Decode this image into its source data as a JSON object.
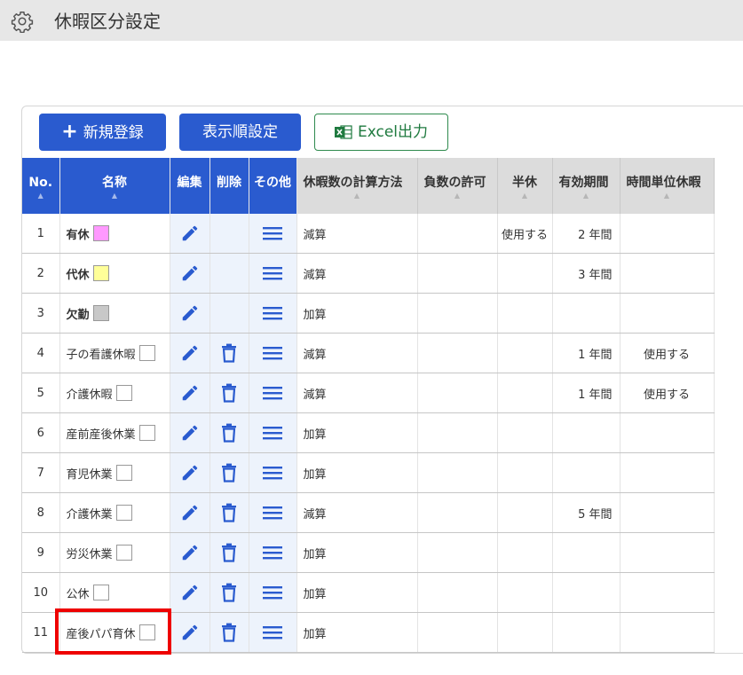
{
  "header": {
    "title": "休暇区分設定",
    "icon": "gear-icon"
  },
  "toolbar": {
    "new_label": "新規登録",
    "order_label": "表示順設定",
    "excel_label": "Excel出力"
  },
  "table": {
    "columns": {
      "no": "No.",
      "name": "名称",
      "edit": "編集",
      "delete": "削除",
      "other": "その他",
      "calc": "休暇数の計算方法",
      "negative": "負数の許可",
      "half": "半休",
      "period": "有効期間",
      "hourly": "時間単位休暇"
    },
    "rows": [
      {
        "no": "1",
        "name": "有休",
        "bold": true,
        "color": "#ff99ff",
        "deletable": false,
        "calc": "減算",
        "negative": "",
        "half": "使用する",
        "period": "2 年間",
        "hourly": ""
      },
      {
        "no": "2",
        "name": "代休",
        "bold": true,
        "color": "#ffff99",
        "deletable": false,
        "calc": "減算",
        "negative": "",
        "half": "",
        "period": "3 年間",
        "hourly": ""
      },
      {
        "no": "3",
        "name": "欠勤",
        "bold": true,
        "color": "#c8c8c8",
        "deletable": false,
        "calc": "加算",
        "negative": "",
        "half": "",
        "period": "",
        "hourly": ""
      },
      {
        "no": "4",
        "name": "子の看護休暇",
        "bold": false,
        "color": "#ffffff",
        "deletable": true,
        "calc": "減算",
        "negative": "",
        "half": "",
        "period": "1 年間",
        "hourly": "使用する"
      },
      {
        "no": "5",
        "name": "介護休暇",
        "bold": false,
        "color": "#ffffff",
        "deletable": true,
        "calc": "減算",
        "negative": "",
        "half": "",
        "period": "1 年間",
        "hourly": "使用する"
      },
      {
        "no": "6",
        "name": "産前産後休業",
        "bold": false,
        "color": "#ffffff",
        "deletable": true,
        "calc": "加算",
        "negative": "",
        "half": "",
        "period": "",
        "hourly": ""
      },
      {
        "no": "7",
        "name": "育児休業",
        "bold": false,
        "color": "#ffffff",
        "deletable": true,
        "calc": "加算",
        "negative": "",
        "half": "",
        "period": "",
        "hourly": ""
      },
      {
        "no": "8",
        "name": "介護休業",
        "bold": false,
        "color": "#ffffff",
        "deletable": true,
        "calc": "減算",
        "negative": "",
        "half": "",
        "period": "5 年間",
        "hourly": ""
      },
      {
        "no": "9",
        "name": "労災休業",
        "bold": false,
        "color": "#ffffff",
        "deletable": true,
        "calc": "加算",
        "negative": "",
        "half": "",
        "period": "",
        "hourly": ""
      },
      {
        "no": "10",
        "name": "公休",
        "bold": false,
        "color": "#ffffff",
        "deletable": true,
        "calc": "加算",
        "negative": "",
        "half": "",
        "period": "",
        "hourly": ""
      },
      {
        "no": "11",
        "name": "産後パパ育休",
        "bold": false,
        "color": "#ffffff",
        "deletable": true,
        "calc": "加算",
        "negative": "",
        "half": "",
        "period": "",
        "hourly": ""
      }
    ]
  },
  "colors": {
    "primary": "#2a5bcf",
    "excel_green": "#1f7a3f",
    "highlight": "#ee0000",
    "action_bg": "#edf3fc"
  },
  "annotation": {
    "highlighted_row": "11"
  }
}
